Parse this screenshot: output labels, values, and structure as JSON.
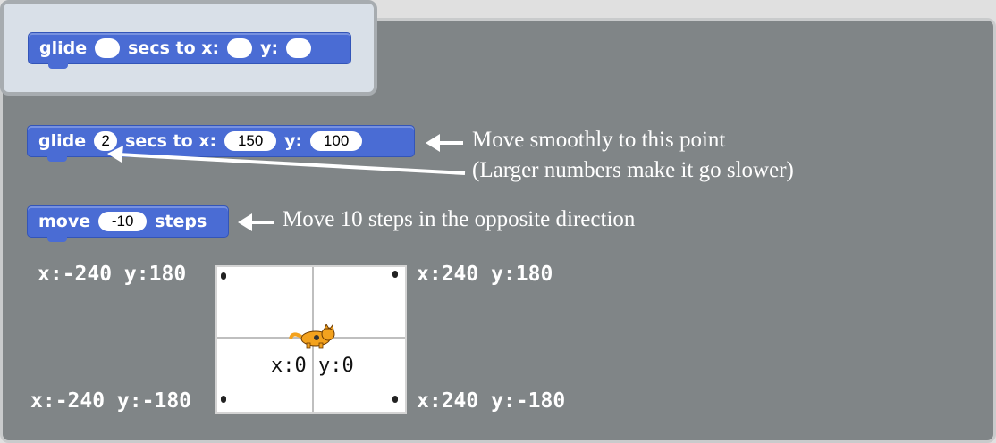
{
  "palette_block": {
    "keyword_glide": "glide",
    "keyword_secs_to_x": "secs to x:",
    "keyword_y": "y:"
  },
  "glide_block": {
    "keyword_glide": "glide",
    "secs_value": "2",
    "keyword_secs_to_x": "secs to x:",
    "x_value": "150",
    "keyword_y": "y:",
    "y_value": "100"
  },
  "move_block": {
    "keyword_move": "move",
    "steps_value": "-10",
    "keyword_steps": "steps"
  },
  "annotations": {
    "glide_note_line1": "Move smoothly to this point",
    "glide_note_line2": "(Larger numbers make it go slower)",
    "move_note": "Move 10 steps in the opposite direction"
  },
  "stage": {
    "top_left": "x:-240 y:180",
    "top_right": "x:240 y:180",
    "bottom_left": "x:-240 y:-180",
    "bottom_right": "x:240 y:-180",
    "center": "x:0 y:0"
  },
  "colors": {
    "block_blue": "#4a6cd4",
    "scripts_bg": "#808587",
    "palette_bg": "#d9e0e8"
  }
}
